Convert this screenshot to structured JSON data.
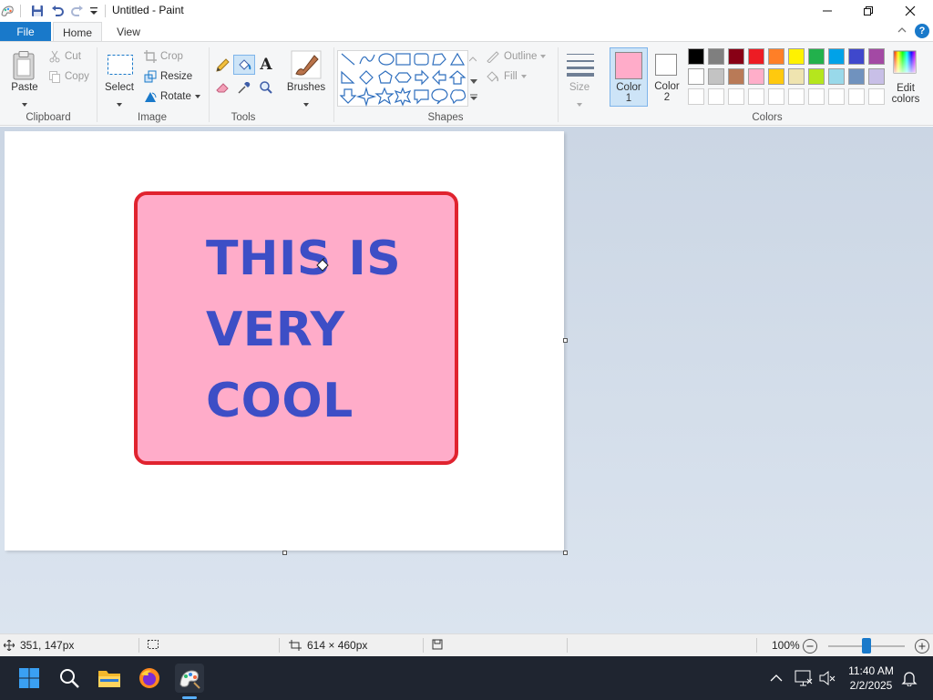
{
  "window": {
    "title": "Untitled - Paint",
    "minimize_icon": "minimize-icon",
    "maximize_icon": "restore-icon",
    "close_icon": "close-icon"
  },
  "tabs": [
    {
      "label": "File"
    },
    {
      "label": "Home"
    },
    {
      "label": "View"
    }
  ],
  "ribbon": {
    "clipboard": {
      "label": "Clipboard",
      "paste": "Paste",
      "cut": "Cut",
      "copy": "Copy"
    },
    "image": {
      "label": "Image",
      "select": "Select",
      "crop": "Crop",
      "resize": "Resize",
      "rotate": "Rotate"
    },
    "tools": {
      "label": "Tools"
    },
    "brushes": {
      "label": "Brushes"
    },
    "shapes": {
      "label": "Shapes",
      "outline": "Outline",
      "fill": "Fill"
    },
    "size": {
      "label": "Size"
    },
    "color1": {
      "label": "Color",
      "num": "1",
      "value": "#ffacc9"
    },
    "color2": {
      "label": "Color",
      "num": "2",
      "value": "#ffffff"
    },
    "colors": {
      "label": "Colors",
      "edit": "Edit colors"
    },
    "palette_row1": [
      "#000000",
      "#7f7f7f",
      "#880015",
      "#ed1c24",
      "#ff7f27",
      "#fff200",
      "#22b14c",
      "#00a2e8",
      "#3f48cc",
      "#a349a4"
    ],
    "palette_row2": [
      "#ffffff",
      "#c3c3c3",
      "#b97a57",
      "#ffaec9",
      "#ffc90e",
      "#efe4b0",
      "#b5e61d",
      "#99d9ea",
      "#7092be",
      "#c8bfe7"
    ]
  },
  "canvas": {
    "card_fill": "#ffacc9",
    "card_border": "#e0232f",
    "text_color": "#3d4ec6",
    "lines": [
      "THIS IS",
      "VERY",
      "COOL"
    ]
  },
  "status": {
    "cursor_pos": "351, 147px",
    "image_size": "614 × 460px",
    "zoom": "100%"
  },
  "taskbar": {
    "time": "11:40 AM",
    "date": "2/2/2025"
  }
}
